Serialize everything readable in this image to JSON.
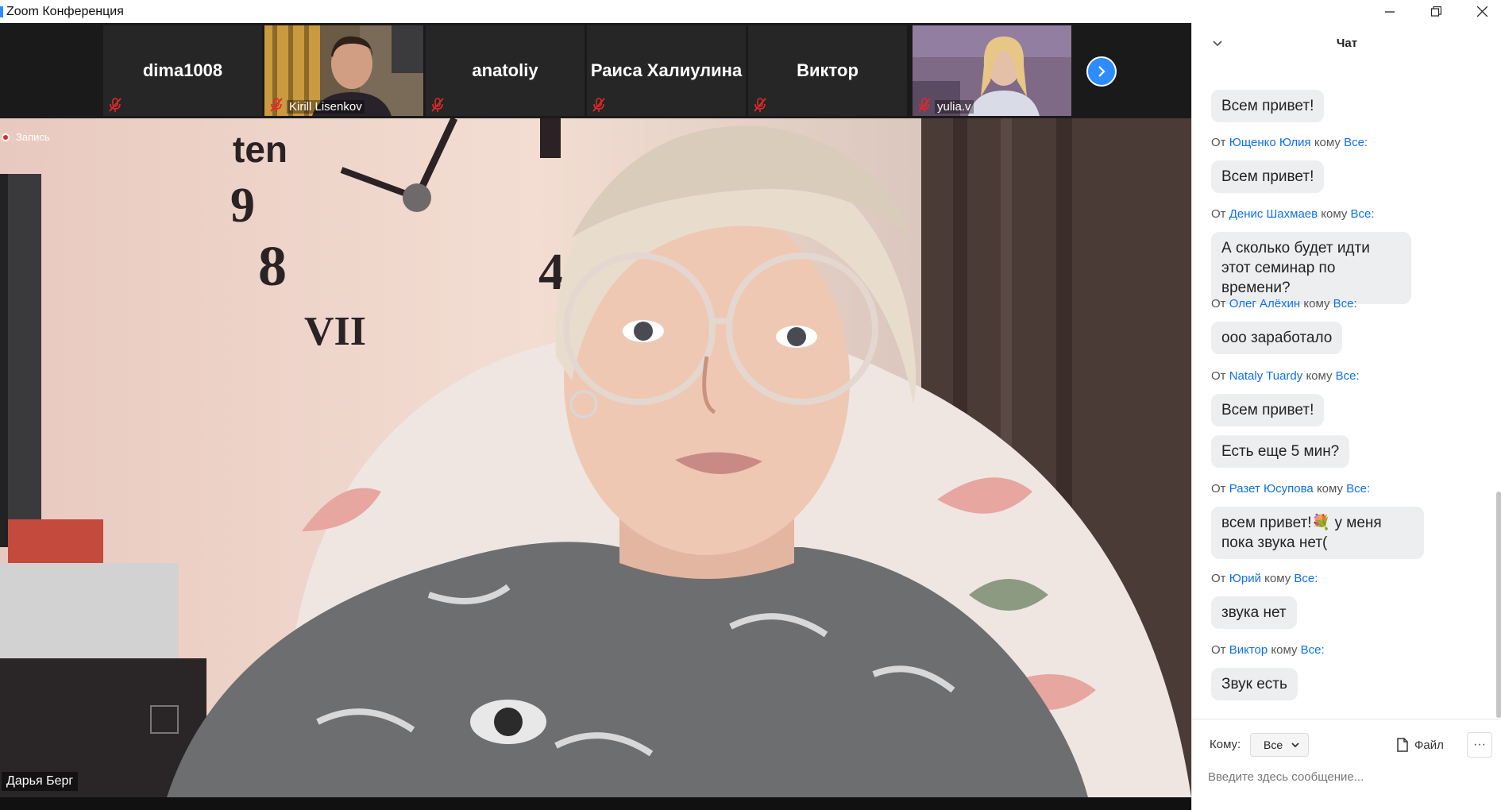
{
  "window": {
    "title": "Zoom Конференция"
  },
  "thumbnails": [
    {
      "name": "dima1008",
      "has_video": false,
      "label": ""
    },
    {
      "name": "",
      "has_video": true,
      "label": "Kirill Lisenkov"
    },
    {
      "name": "anatoliy",
      "has_video": false,
      "label": ""
    },
    {
      "name": "Раиса Халиулина",
      "has_video": false,
      "label": ""
    },
    {
      "name": "Виктор",
      "has_video": false,
      "label": ""
    },
    {
      "name": "",
      "has_video": true,
      "label": "yulia.v"
    }
  ],
  "main": {
    "recording_label": "Запись",
    "speaker_name": "Дарья Берг"
  },
  "chat": {
    "title": "Чат",
    "prefix_from": "От",
    "prefix_to": "кому",
    "messages": [
      {
        "from": "",
        "to": "",
        "text": "Всем привет!"
      },
      {
        "from": "Ющенко Юлия",
        "to": "Все:",
        "text": "Всем привет!"
      },
      {
        "from": "Денис Шахмаев",
        "to": "Все:",
        "text": "А сколько будет идти этот семинар по времени?"
      },
      {
        "from": "Олег Алёхин",
        "to": "Все:",
        "text": "ооо заработало"
      },
      {
        "from": "Nataly Tuardy",
        "to": "Все:",
        "text": "Всем привет!"
      },
      {
        "from": "",
        "to": "",
        "text": "Есть еще 5 мин?"
      },
      {
        "from": "Разет Юсупова",
        "to": "Все:",
        "text": "всем привет!💐 у меня пока звука нет("
      },
      {
        "from": "Юрий",
        "to": "Все:",
        "text": "звука нет"
      },
      {
        "from": "Виктор",
        "to": "Все:",
        "text": "Звук есть"
      }
    ],
    "to_label": "Кому:",
    "to_value": "Все",
    "file_label": "Файл",
    "more_label": "···",
    "input_placeholder": "Введите здесь сообщение..."
  },
  "colors": {
    "accent": "#2d8cff",
    "link": "#0e71eb",
    "bubble": "#edeef0",
    "mic_muted": "#e02828"
  }
}
